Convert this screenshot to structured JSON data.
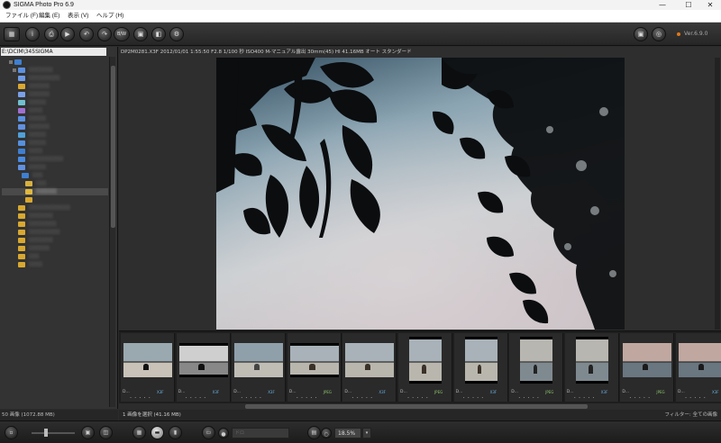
{
  "window": {
    "title": "SIGMA Photo Pro 6.9",
    "controls": {
      "minimize": "—",
      "maximize": "☐",
      "close": "✕"
    }
  },
  "menu": [
    "ファイル (F)",
    "編集 (E)",
    "表示 (V)",
    "ヘルプ (H)"
  ],
  "toolbar": {
    "buttons": [
      {
        "icon": "grid-icon",
        "glyph": "▦"
      },
      {
        "icon": "info-icon",
        "glyph": "i"
      },
      {
        "icon": "print-icon",
        "glyph": "⎙"
      },
      {
        "icon": "slideshow-icon",
        "glyph": "▶"
      },
      {
        "icon": "rotate-left-icon",
        "glyph": "↶"
      },
      {
        "icon": "rotate-right-icon",
        "glyph": "↷"
      },
      {
        "icon": "bw-icon",
        "glyph": "B/W"
      },
      {
        "icon": "save-icon",
        "glyph": "▣"
      },
      {
        "icon": "color-mode-icon",
        "glyph": "◧"
      },
      {
        "icon": "settings-icon",
        "glyph": "⚙"
      }
    ],
    "right_buttons": [
      {
        "icon": "preferences-icon",
        "glyph": "▣"
      },
      {
        "icon": "help-icon",
        "glyph": "◎"
      }
    ],
    "version": "Ver.6.9.0"
  },
  "folder_panel": {
    "path": "E:\\DCIM\\345SIGMA",
    "status": "50 画像 (1072.88 MB)"
  },
  "viewer": {
    "info": "DP2M0281.X3F  2012/01/01  1:55:50  F2.8  1/100  秒  ISO400  M-マニュアル露出  30mm(45)  HI  41.16MB  オート  スタンダード"
  },
  "filmstrip": {
    "thumbnails": [
      {
        "label": "D...",
        "tag": "X3F",
        "tag_color": "#6ab0e0",
        "type": "wide",
        "subject": "boat"
      },
      {
        "label": "D...",
        "tag": "X3F",
        "tag_color": "#6ab0e0",
        "type": "wide-dark",
        "subject": "bw"
      },
      {
        "label": "D...",
        "tag": "X3F",
        "tag_color": "#6ab0e0",
        "type": "wide",
        "subject": "sky"
      },
      {
        "label": "D...",
        "tag": "JPEG",
        "tag_color": "#8ac06a",
        "type": "wide-border",
        "subject": "rock"
      },
      {
        "label": "D...",
        "tag": "X3F",
        "tag_color": "#6ab0e0",
        "type": "wide",
        "subject": "rock"
      },
      {
        "label": "D...",
        "tag": "JPEG",
        "tag_color": "#8ac06a",
        "type": "tall",
        "subject": "rock"
      },
      {
        "label": "D...",
        "tag": "X3F",
        "tag_color": "#6ab0e0",
        "type": "tall",
        "subject": "rock"
      },
      {
        "label": "D...",
        "tag": "JPEG",
        "tag_color": "#8ac06a",
        "type": "tall",
        "subject": "sea"
      },
      {
        "label": "D...",
        "tag": "X3F",
        "tag_color": "#6ab0e0",
        "type": "tall",
        "subject": "sea"
      },
      {
        "label": "D...",
        "tag": "JPEG",
        "tag_color": "#8ac06a",
        "type": "wide",
        "subject": "sunset"
      },
      {
        "label": "D...",
        "tag": "X3F",
        "tag_color": "#6ab0e0",
        "type": "wide",
        "subject": "sunset"
      }
    ],
    "stars": "• • • • •"
  },
  "statusbar": {
    "left": "1 画像を選択 (41.16 MB)",
    "right": "フィルター: 全ての画像"
  },
  "bottombar": {
    "zoom": "18.5%",
    "zoom_arrow": "▾",
    "combo_placeholder": "ドロ"
  }
}
